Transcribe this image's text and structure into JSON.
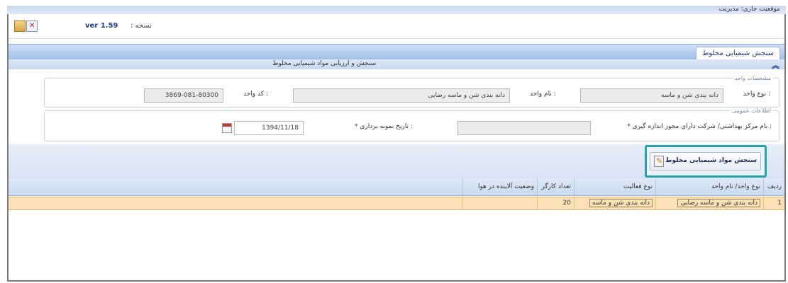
{
  "window": {
    "title": "موقعیت جاری: مدیریت"
  },
  "toolbar": {
    "version": "ver 1.59",
    "version_label": ": نسخه",
    "icons": [
      "open-icon",
      "close-icon"
    ]
  },
  "panel": {
    "tab_label": "سنجش شیمیایی مخلوط",
    "sub_title": "سنجش و ارزیابی مواد شیمیایی مخلوط"
  },
  "unit_info": {
    "legend": "مشخصات واحد",
    "unit_type_label": "نوع واحد :",
    "unit_type_value": "دانه بندی شن و ماسه",
    "unit_name_label": "نام واحد :",
    "unit_name_value": "دانه بندی شن و ماسه رضایی",
    "unit_code_label": "کد واحد :",
    "unit_code_value": "3869-081-80300"
  },
  "measurement_info": {
    "legend": "اطلاعات عمومی",
    "company_label": "* نام مرکز بهداشتی/ شرکت دارای مجوز اندازه گیری :",
    "company_value": "",
    "date_label": "* تاریخ نمونه برداری :",
    "date_value": "1394/11/18"
  },
  "action": {
    "measure_button_label": "سنجش مواد شیمیایی مخلوط"
  },
  "grid": {
    "columns": [
      "ردیف",
      "نوع واحد/ نام واحد",
      "نوع فعالیت",
      "تعداد کارگر",
      "وضعیت آلاینده در هوا"
    ],
    "rows": [
      {
        "index": "1",
        "unit": "دانه بندی شن و ماسه رضایی",
        "activity": "دانه بندی شن و ماسه",
        "workers": "20",
        "status": ""
      }
    ]
  }
}
